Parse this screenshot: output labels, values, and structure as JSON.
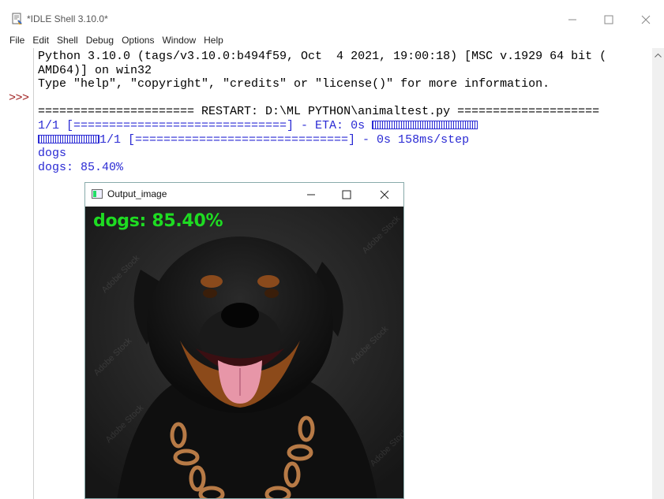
{
  "window": {
    "title": "*IDLE Shell 3.10.0*"
  },
  "menu": [
    "File",
    "Edit",
    "Shell",
    "Debug",
    "Options",
    "Window",
    "Help"
  ],
  "shell": {
    "prompt": ">>>",
    "lines": [
      "Python 3.10.0 (tags/v3.10.0:b494f59, Oct  4 2021, 19:00:18) [MSC v.1929 64 bit (",
      "AMD64)] on win32",
      "Type \"help\", \"copyright\", \"credits\" or \"license()\" for more information.",
      "",
      "====================== RESTART: D:\\ML PYTHON\\animaltest.py ====================",
      "1/1 [==============================] - ETA: 0s ",
      "1/1 [==============================] - 0s 158ms/step",
      "dogs",
      "dogs: 85.40%"
    ]
  },
  "output_window": {
    "title": "Output_image",
    "prediction_label": "dogs: 85.40%",
    "watermark": "Adobe Stock"
  },
  "colors": {
    "output_text": "#2a2ad4",
    "prompt": "#a02020",
    "label_green": "#1edc22"
  }
}
